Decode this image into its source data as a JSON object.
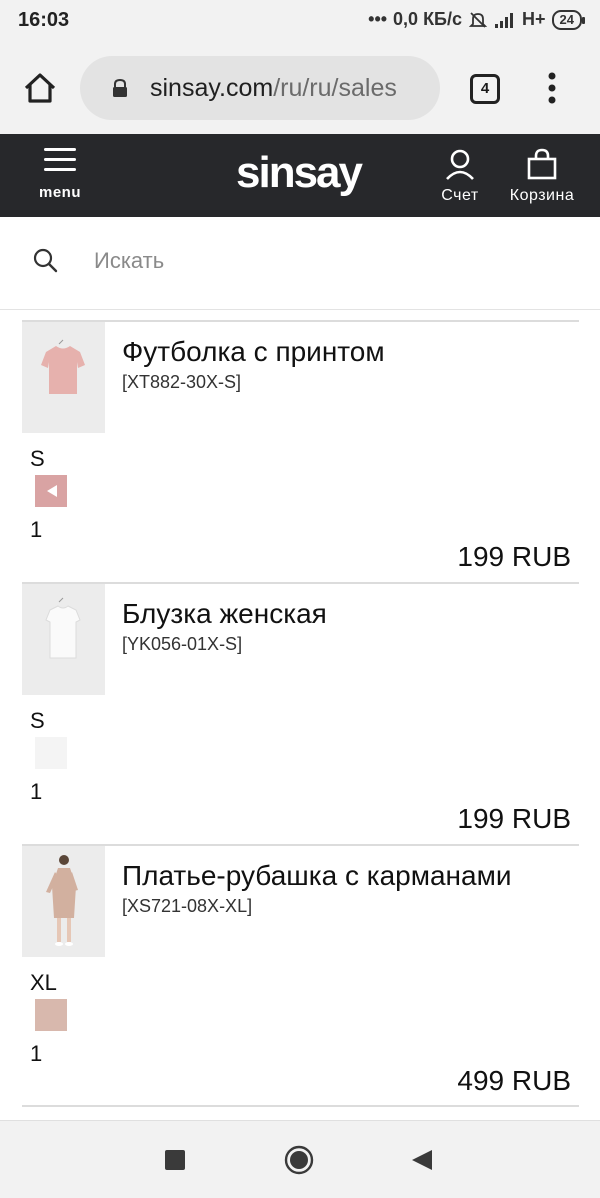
{
  "status_bar": {
    "time": "16:03",
    "network_speed": "0,0 КБ/с",
    "network_type": "H+",
    "battery": "24"
  },
  "browser": {
    "url_domain": "sinsay.com",
    "url_path": "/ru/ru/sales",
    "tab_count": "4"
  },
  "header": {
    "menu_label": "menu",
    "logo_text": "sinsay",
    "account_label": "Счет",
    "cart_label": "Корзина",
    "background": "#27282b"
  },
  "search": {
    "placeholder": "Искать"
  },
  "cart_items": [
    {
      "name": "Футболка с принтом",
      "sku": "[XT882-30X-S]",
      "size": "S",
      "swatch_color": "#d9a3a3",
      "quantity": "1",
      "price": "199 RUB"
    },
    {
      "name": "Блузка женская",
      "sku": "[YK056-01X-S]",
      "size": "S",
      "swatch_color": "#f4f4f4",
      "quantity": "1",
      "price": "199 RUB"
    },
    {
      "name": "Платье-рубашка с карманами",
      "sku": "[XS721-08X-XL]",
      "size": "XL",
      "swatch_color": "#d8b8ad",
      "quantity": "1",
      "price": "499 RUB"
    }
  ],
  "nav": {
    "recents": "recents-icon",
    "home": "home-circle-icon",
    "back": "back-triangle-icon"
  }
}
